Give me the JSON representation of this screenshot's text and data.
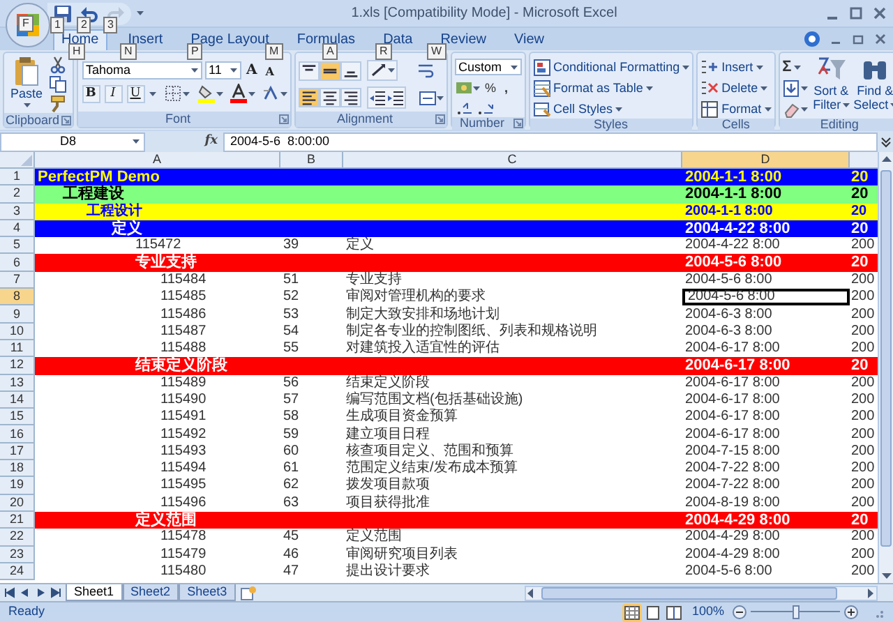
{
  "window": {
    "title": "1.xls  [Compatibility Mode] - Microsoft Excel",
    "office_keytip": "F"
  },
  "quick_access": [
    {
      "kind": "save",
      "keytip": "1",
      "disabled": false
    },
    {
      "kind": "undo",
      "keytip": "2",
      "disabled": false
    },
    {
      "kind": "redo",
      "keytip": "3",
      "disabled": true
    }
  ],
  "tabs": [
    {
      "label": "Home",
      "keytip": "H",
      "selected": true
    },
    {
      "label": "Insert",
      "keytip": "N",
      "selected": false
    },
    {
      "label": "Page Layout",
      "keytip": "P",
      "selected": false
    },
    {
      "label": "Formulas",
      "keytip": "M",
      "selected": false
    },
    {
      "label": "Data",
      "keytip": "A",
      "selected": false
    },
    {
      "label": "Review",
      "keytip": "R",
      "selected": false
    },
    {
      "label": "View",
      "keytip": "W",
      "selected": false
    }
  ],
  "ribbon": {
    "clipboard": {
      "paste": "Paste",
      "label": "Clipboard"
    },
    "font": {
      "name": "Tahoma",
      "size": "11",
      "grow": "A",
      "shrink": "A",
      "bold": "B",
      "italic": "I",
      "underline": "U",
      "label": "Font"
    },
    "alignment": {
      "vertical": [
        {
          "kind": "top",
          "selected": false
        },
        {
          "kind": "middle",
          "selected": true
        },
        {
          "kind": "bottom",
          "selected": false
        }
      ],
      "horizontal": [
        {
          "kind": "left",
          "selected": true
        },
        {
          "kind": "center",
          "selected": false
        },
        {
          "kind": "right",
          "selected": false
        }
      ],
      "label": "Alignment"
    },
    "number": {
      "format": "Custom",
      "percent": "%",
      "comma": ",",
      "label": "Number"
    },
    "styles": {
      "items": [
        "Conditional Formatting",
        "Format as Table",
        "Cell Styles"
      ],
      "label": "Styles"
    },
    "cells": {
      "items": [
        "Insert",
        "Delete",
        "Format"
      ],
      "label": "Cells"
    },
    "editing": {
      "sum": "Σ",
      "sort": [
        "Sort &",
        "Filter"
      ],
      "find": [
        "Find &",
        "Select"
      ],
      "label": "Editing"
    }
  },
  "formula_bar": {
    "name_box": "D8",
    "fx": "fx",
    "value": "2004-5-6  8:00:00"
  },
  "columns": [
    {
      "label": "A",
      "selected": false
    },
    {
      "label": "B",
      "selected": false
    },
    {
      "label": "C",
      "selected": false
    },
    {
      "label": "D",
      "selected": true
    }
  ],
  "rows": [
    {
      "number": "1",
      "kind": "title",
      "a": "PerfectPM Demo",
      "d": "2004-1-1 8:00",
      "e": "20",
      "selected": false,
      "children": [
        {
          "number": "2",
          "kind": "phase",
          "a": "工程建设",
          "d": "2004-1-1 8:00",
          "e": "20",
          "selected": false,
          "children": [
            {
              "number": "3",
              "kind": "stage",
              "a": "工程设计",
              "d": "2004-1-1 8:00",
              "e": "20",
              "selected": false,
              "children": [
                {
                  "number": "4",
                  "kind": "group",
                  "a": "定义",
                  "d": "2004-4-22 8:00",
                  "e": "20",
                  "selected": false,
                  "children": [
                    {
                      "number": "5",
                      "kind": "task",
                      "a": "115472",
                      "b": "39",
                      "c": "定义",
                      "d": "2004-4-22 8:00",
                      "e": "200",
                      "selected": false
                    },
                    {
                      "number": "6",
                      "kind": "summary",
                      "a": "专业支持",
                      "d": "2004-5-6 8:00",
                      "e": "20",
                      "selected": false,
                      "children": [
                        {
                          "number": "7",
                          "kind": "task",
                          "a": "115484",
                          "b": "51",
                          "c": "专业支持",
                          "d": "2004-5-6 8:00",
                          "e": "200",
                          "selected": false
                        },
                        {
                          "number": "8",
                          "kind": "task",
                          "a": "115485",
                          "b": "52",
                          "c": "审阅对管理机构的要求",
                          "d": "2004-5-6 8:00",
                          "e": "200",
                          "selected": true
                        },
                        {
                          "number": "9",
                          "kind": "task",
                          "a": "115486",
                          "b": "53",
                          "c": "制定大致安排和场地计划",
                          "d": "2004-6-3 8:00",
                          "e": "200",
                          "selected": false
                        },
                        {
                          "number": "10",
                          "kind": "task",
                          "a": "115487",
                          "b": "54",
                          "c": "制定各专业的控制图纸、列表和规格说明",
                          "d": "2004-6-3 8:00",
                          "e": "200",
                          "selected": false
                        },
                        {
                          "number": "11",
                          "kind": "task",
                          "a": "115488",
                          "b": "55",
                          "c": "对建筑投入适宜性的评估",
                          "d": "2004-6-17 8:00",
                          "e": "200",
                          "selected": false
                        }
                      ]
                    },
                    {
                      "number": "12",
                      "kind": "summary",
                      "a": "结束定义阶段",
                      "d": "2004-6-17 8:00",
                      "e": "20",
                      "selected": false,
                      "children": [
                        {
                          "number": "13",
                          "kind": "task",
                          "a": "115489",
                          "b": "56",
                          "c": "结束定义阶段",
                          "d": "2004-6-17 8:00",
                          "e": "200",
                          "selected": false
                        },
                        {
                          "number": "14",
                          "kind": "task",
                          "a": "115490",
                          "b": "57",
                          "c": "编写范围文档(包括基础设施)",
                          "d": "2004-6-17 8:00",
                          "e": "200",
                          "selected": false
                        },
                        {
                          "number": "15",
                          "kind": "task",
                          "a": "115491",
                          "b": "58",
                          "c": "生成项目资金预算",
                          "d": "2004-6-17 8:00",
                          "e": "200",
                          "selected": false
                        },
                        {
                          "number": "16",
                          "kind": "task",
                          "a": "115492",
                          "b": "59",
                          "c": "建立项目日程",
                          "d": "2004-6-17 8:00",
                          "e": "200",
                          "selected": false
                        },
                        {
                          "number": "17",
                          "kind": "task",
                          "a": "115493",
                          "b": "60",
                          "c": "核查项目定义、范围和预算",
                          "d": "2004-7-15 8:00",
                          "e": "200",
                          "selected": false
                        },
                        {
                          "number": "18",
                          "kind": "task",
                          "a": "115494",
                          "b": "61",
                          "c": "范围定义结束/发布成本预算",
                          "d": "2004-7-22 8:00",
                          "e": "200",
                          "selected": false
                        },
                        {
                          "number": "19",
                          "kind": "task",
                          "a": "115495",
                          "b": "62",
                          "c": "拨发项目款项",
                          "d": "2004-7-22 8:00",
                          "e": "200",
                          "selected": false
                        },
                        {
                          "number": "20",
                          "kind": "task",
                          "a": "115496",
                          "b": "63",
                          "c": "项目获得批准",
                          "d": "2004-8-19 8:00",
                          "e": "200",
                          "selected": false
                        }
                      ]
                    },
                    {
                      "number": "21",
                      "kind": "summary",
                      "a": "定义范围",
                      "d": "2004-4-29 8:00",
                      "e": "20",
                      "selected": false,
                      "children": [
                        {
                          "number": "22",
                          "kind": "task",
                          "a": "115478",
                          "b": "45",
                          "c": "定义范围",
                          "d": "2004-4-29 8:00",
                          "e": "200",
                          "selected": false
                        },
                        {
                          "number": "23",
                          "kind": "task",
                          "a": "115479",
                          "b": "46",
                          "c": "审阅研究项目列表",
                          "d": "2004-4-29 8:00",
                          "e": "200",
                          "selected": false
                        },
                        {
                          "number": "24",
                          "kind": "task",
                          "a": "115480",
                          "b": "47",
                          "c": "提出设计要求",
                          "d": "2004-5-6 8:00",
                          "e": "200",
                          "selected": false
                        }
                      ]
                    }
                  ]
                }
              ]
            }
          ]
        }
      ]
    }
  ],
  "sheets": [
    {
      "label": "Sheet1",
      "selected": true
    },
    {
      "label": "Sheet2",
      "selected": false
    },
    {
      "label": "Sheet3",
      "selected": false
    }
  ],
  "status_bar": {
    "text": "Ready",
    "views": [
      {
        "kind": "normal",
        "selected": true
      },
      {
        "kind": "page_layout",
        "selected": false
      },
      {
        "kind": "page_break",
        "selected": false
      }
    ],
    "zoom": "100%",
    "zoom_slider": {
      "level": 0.5
    }
  }
}
